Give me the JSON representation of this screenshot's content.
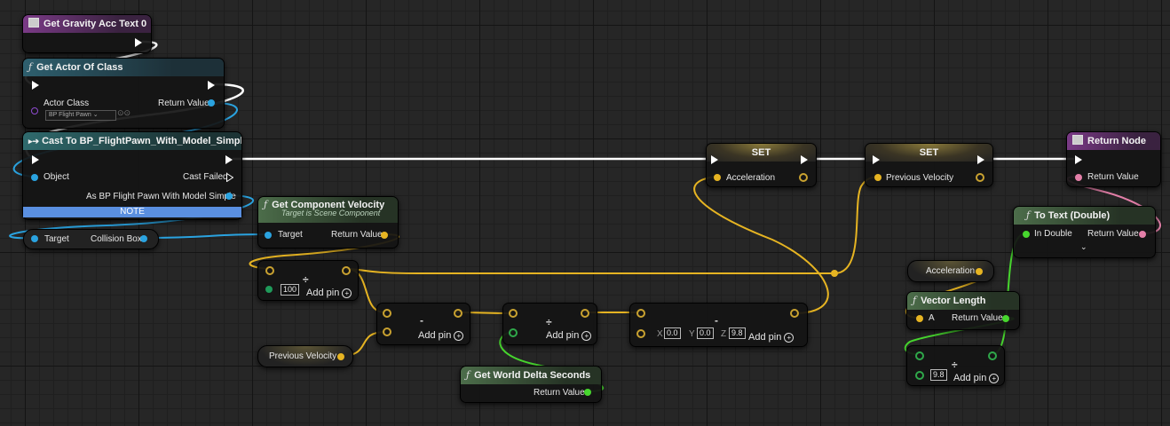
{
  "nodes": {
    "get_gravity": {
      "title": "Get Gravity Acc Text 0"
    },
    "get_actor": {
      "title": "Get Actor Of Class",
      "actor_class_label": "Actor Class",
      "actor_class_value": "BP Flight Pawn",
      "return_label": "Return Value"
    },
    "cast": {
      "title": "Cast To BP_FlightPawn_With_Model_Simple",
      "object_label": "Object",
      "cast_failed_label": "Cast Failed",
      "as_label": "As BP Flight Pawn With Model Simple",
      "note_label": "NOTE"
    },
    "target_collision": {
      "target_label": "Target",
      "collision_label": "Collision Box"
    },
    "get_component_velocity": {
      "title": "Get Component Velocity",
      "subtitle": "Target is Scene Component",
      "target_label": "Target",
      "return_label": "Return Value"
    },
    "set_accel": {
      "title": "SET",
      "pin_label": "Acceleration"
    },
    "set_prev": {
      "title": "SET",
      "pin_label": "Previous Velocity"
    },
    "return_node": {
      "title": "Return Node",
      "return_label": "Return Value"
    },
    "divide1": {
      "op": "÷",
      "value": "100",
      "add_pin": "Add pin"
    },
    "subtract": {
      "op": "-",
      "add_pin": "Add pin"
    },
    "divide2": {
      "op": "÷",
      "add_pin": "Add pin"
    },
    "subtract_vec": {
      "op": "-",
      "x_label": "X",
      "x_value": "0.0",
      "y_label": "Y",
      "y_value": "0.0",
      "z_label": "Z",
      "z_value": "9.8",
      "add_pin": "Add pin"
    },
    "previous_velocity_var": {
      "label": "Previous Velocity"
    },
    "world_delta": {
      "title": "Get World Delta Seconds",
      "return_label": "Return Value"
    },
    "to_text": {
      "title": "To Text (Double)",
      "in_label": "In Double",
      "return_label": "Return Value"
    },
    "acceleration_var": {
      "label": "Acceleration"
    },
    "vector_length": {
      "title": "Vector Length",
      "a_label": "A",
      "return_label": "Return Value"
    },
    "divide3": {
      "op": "÷",
      "value": "9.8",
      "add_pin": "Add pin"
    }
  },
  "colors": {
    "exec": "#ffffff",
    "object": "#2aa3e0",
    "vector": "#e6b422",
    "float": "#47d62e",
    "text": "#e37fa8",
    "class": "#8f4bd0"
  }
}
